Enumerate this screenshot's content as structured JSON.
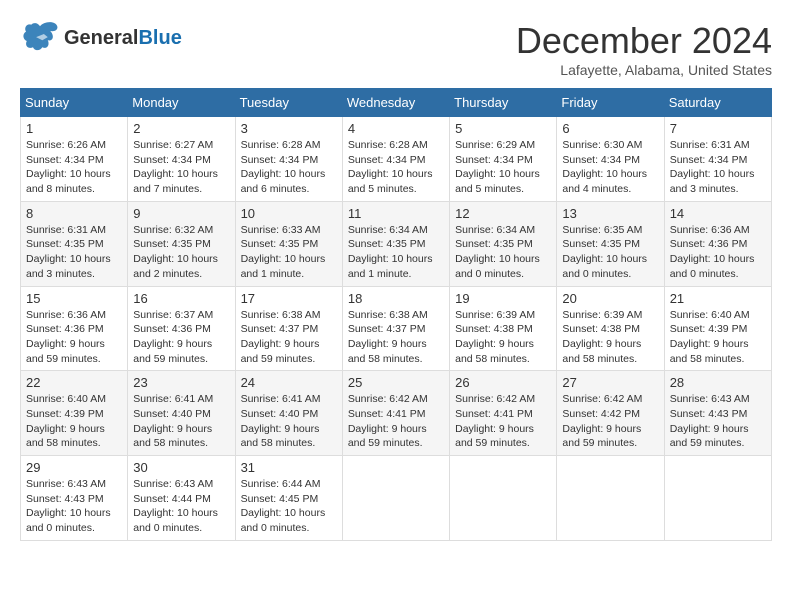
{
  "header": {
    "logo_general": "General",
    "logo_blue": "Blue",
    "month_title": "December 2024",
    "location": "Lafayette, Alabama, United States"
  },
  "weekdays": [
    "Sunday",
    "Monday",
    "Tuesday",
    "Wednesday",
    "Thursday",
    "Friday",
    "Saturday"
  ],
  "weeks": [
    [
      {
        "day": "1",
        "sunrise": "Sunrise: 6:26 AM",
        "sunset": "Sunset: 4:34 PM",
        "daylight": "Daylight: 10 hours and 8 minutes."
      },
      {
        "day": "2",
        "sunrise": "Sunrise: 6:27 AM",
        "sunset": "Sunset: 4:34 PM",
        "daylight": "Daylight: 10 hours and 7 minutes."
      },
      {
        "day": "3",
        "sunrise": "Sunrise: 6:28 AM",
        "sunset": "Sunset: 4:34 PM",
        "daylight": "Daylight: 10 hours and 6 minutes."
      },
      {
        "day": "4",
        "sunrise": "Sunrise: 6:28 AM",
        "sunset": "Sunset: 4:34 PM",
        "daylight": "Daylight: 10 hours and 5 minutes."
      },
      {
        "day": "5",
        "sunrise": "Sunrise: 6:29 AM",
        "sunset": "Sunset: 4:34 PM",
        "daylight": "Daylight: 10 hours and 5 minutes."
      },
      {
        "day": "6",
        "sunrise": "Sunrise: 6:30 AM",
        "sunset": "Sunset: 4:34 PM",
        "daylight": "Daylight: 10 hours and 4 minutes."
      },
      {
        "day": "7",
        "sunrise": "Sunrise: 6:31 AM",
        "sunset": "Sunset: 4:34 PM",
        "daylight": "Daylight: 10 hours and 3 minutes."
      }
    ],
    [
      {
        "day": "8",
        "sunrise": "Sunrise: 6:31 AM",
        "sunset": "Sunset: 4:35 PM",
        "daylight": "Daylight: 10 hours and 3 minutes."
      },
      {
        "day": "9",
        "sunrise": "Sunrise: 6:32 AM",
        "sunset": "Sunset: 4:35 PM",
        "daylight": "Daylight: 10 hours and 2 minutes."
      },
      {
        "day": "10",
        "sunrise": "Sunrise: 6:33 AM",
        "sunset": "Sunset: 4:35 PM",
        "daylight": "Daylight: 10 hours and 1 minute."
      },
      {
        "day": "11",
        "sunrise": "Sunrise: 6:34 AM",
        "sunset": "Sunset: 4:35 PM",
        "daylight": "Daylight: 10 hours and 1 minute."
      },
      {
        "day": "12",
        "sunrise": "Sunrise: 6:34 AM",
        "sunset": "Sunset: 4:35 PM",
        "daylight": "Daylight: 10 hours and 0 minutes."
      },
      {
        "day": "13",
        "sunrise": "Sunrise: 6:35 AM",
        "sunset": "Sunset: 4:35 PM",
        "daylight": "Daylight: 10 hours and 0 minutes."
      },
      {
        "day": "14",
        "sunrise": "Sunrise: 6:36 AM",
        "sunset": "Sunset: 4:36 PM",
        "daylight": "Daylight: 10 hours and 0 minutes."
      }
    ],
    [
      {
        "day": "15",
        "sunrise": "Sunrise: 6:36 AM",
        "sunset": "Sunset: 4:36 PM",
        "daylight": "Daylight: 9 hours and 59 minutes."
      },
      {
        "day": "16",
        "sunrise": "Sunrise: 6:37 AM",
        "sunset": "Sunset: 4:36 PM",
        "daylight": "Daylight: 9 hours and 59 minutes."
      },
      {
        "day": "17",
        "sunrise": "Sunrise: 6:38 AM",
        "sunset": "Sunset: 4:37 PM",
        "daylight": "Daylight: 9 hours and 59 minutes."
      },
      {
        "day": "18",
        "sunrise": "Sunrise: 6:38 AM",
        "sunset": "Sunset: 4:37 PM",
        "daylight": "Daylight: 9 hours and 58 minutes."
      },
      {
        "day": "19",
        "sunrise": "Sunrise: 6:39 AM",
        "sunset": "Sunset: 4:38 PM",
        "daylight": "Daylight: 9 hours and 58 minutes."
      },
      {
        "day": "20",
        "sunrise": "Sunrise: 6:39 AM",
        "sunset": "Sunset: 4:38 PM",
        "daylight": "Daylight: 9 hours and 58 minutes."
      },
      {
        "day": "21",
        "sunrise": "Sunrise: 6:40 AM",
        "sunset": "Sunset: 4:39 PM",
        "daylight": "Daylight: 9 hours and 58 minutes."
      }
    ],
    [
      {
        "day": "22",
        "sunrise": "Sunrise: 6:40 AM",
        "sunset": "Sunset: 4:39 PM",
        "daylight": "Daylight: 9 hours and 58 minutes."
      },
      {
        "day": "23",
        "sunrise": "Sunrise: 6:41 AM",
        "sunset": "Sunset: 4:40 PM",
        "daylight": "Daylight: 9 hours and 58 minutes."
      },
      {
        "day": "24",
        "sunrise": "Sunrise: 6:41 AM",
        "sunset": "Sunset: 4:40 PM",
        "daylight": "Daylight: 9 hours and 58 minutes."
      },
      {
        "day": "25",
        "sunrise": "Sunrise: 6:42 AM",
        "sunset": "Sunset: 4:41 PM",
        "daylight": "Daylight: 9 hours and 59 minutes."
      },
      {
        "day": "26",
        "sunrise": "Sunrise: 6:42 AM",
        "sunset": "Sunset: 4:41 PM",
        "daylight": "Daylight: 9 hours and 59 minutes."
      },
      {
        "day": "27",
        "sunrise": "Sunrise: 6:42 AM",
        "sunset": "Sunset: 4:42 PM",
        "daylight": "Daylight: 9 hours and 59 minutes."
      },
      {
        "day": "28",
        "sunrise": "Sunrise: 6:43 AM",
        "sunset": "Sunset: 4:43 PM",
        "daylight": "Daylight: 9 hours and 59 minutes."
      }
    ],
    [
      {
        "day": "29",
        "sunrise": "Sunrise: 6:43 AM",
        "sunset": "Sunset: 4:43 PM",
        "daylight": "Daylight: 10 hours and 0 minutes."
      },
      {
        "day": "30",
        "sunrise": "Sunrise: 6:43 AM",
        "sunset": "Sunset: 4:44 PM",
        "daylight": "Daylight: 10 hours and 0 minutes."
      },
      {
        "day": "31",
        "sunrise": "Sunrise: 6:44 AM",
        "sunset": "Sunset: 4:45 PM",
        "daylight": "Daylight: 10 hours and 0 minutes."
      },
      null,
      null,
      null,
      null
    ]
  ]
}
